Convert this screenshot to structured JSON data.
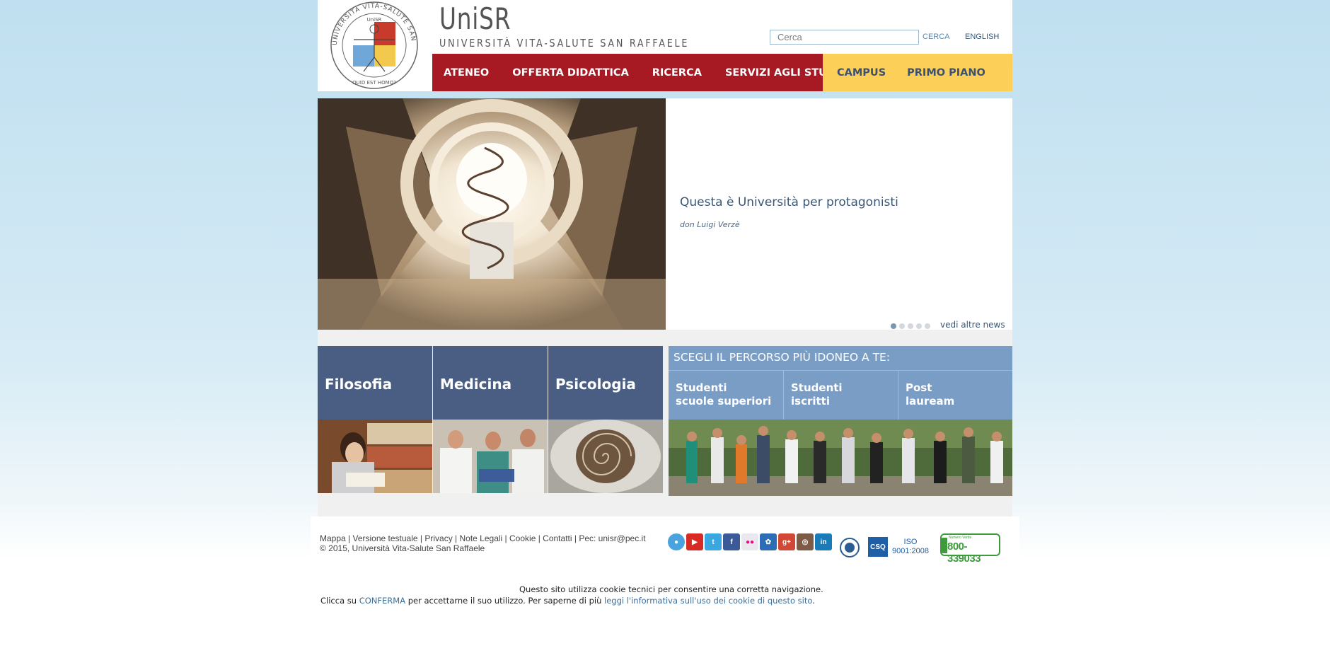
{
  "header": {
    "brand_title": "UniSR",
    "brand_subtitle": "UNIVERSITÀ VITA-SALUTE SAN RAFFAELE",
    "seal_text": "UNIVERSITÀ VITA-SALUTE SAN RAFFAELE",
    "seal_center": "UniSR",
    "seal_motto": "QUID EST HOMO?",
    "search_placeholder": "Cerca",
    "search_button": "CERCA",
    "language_link": "ENGLISH"
  },
  "nav": {
    "primary": [
      "ATENEO",
      "OFFERTA DIDATTICA",
      "RICERCA",
      "SERVIZI AGLI STUDENTI"
    ],
    "secondary": [
      "CAMPUS",
      "PRIMO PIANO"
    ]
  },
  "hero": {
    "title": "Questa è Università per protagonisti",
    "author": "don Luigi Verzè",
    "slides_total": 5,
    "active_slide": 1,
    "more_news": "vedi altre news"
  },
  "faculties": [
    "Filosofia",
    "Medicina",
    "Psicologia"
  ],
  "paths": {
    "heading": "SCEGLI IL PERCORSO PIÙ IDONEO A TE:",
    "items": [
      {
        "line1": "Studenti",
        "line2": "scuole superiori"
      },
      {
        "line1": "Studenti",
        "line2": "iscritti"
      },
      {
        "line1": "Post",
        "line2": "lauream"
      }
    ]
  },
  "footer": {
    "links": [
      "Mappa",
      "Versione testuale",
      "Privacy",
      "Note Legali",
      "Cookie",
      "Contatti"
    ],
    "pec": "Pec: unisr@pec.it",
    "copyright": "© 2015, Università Vita-Salute San Raffaele",
    "social_icons": [
      "periscope-icon",
      "youtube-icon",
      "twitter-icon",
      "facebook-icon",
      "flickr-icon",
      "myspace-icon",
      "google-plus-icon",
      "instagram-icon",
      "linkedin-icon"
    ],
    "cert_label": "CSQ",
    "iso_line1": "ISO",
    "iso_line2": "9001:2008",
    "green_label": "Numero Verde",
    "green_number": "800-339033"
  },
  "cookie": {
    "line1": "Questo sito utilizza cookie tecnici per consentire una corretta navigazione.",
    "line2_pre": "Clicca su ",
    "confirm": "CONFERMA",
    "line2_mid": " per accettarne il suo utilizzo. Per saperne di più ",
    "info_link": "leggi l'informativa sull'uso dei cookie di questo sito",
    "line2_end": "."
  },
  "colors": {
    "nav_red": "#a81a23",
    "nav_yellow": "#fccf58",
    "faculty_blue": "#4a5e83",
    "path_blue": "#7a9dc6",
    "text_blue": "#3a5574"
  }
}
